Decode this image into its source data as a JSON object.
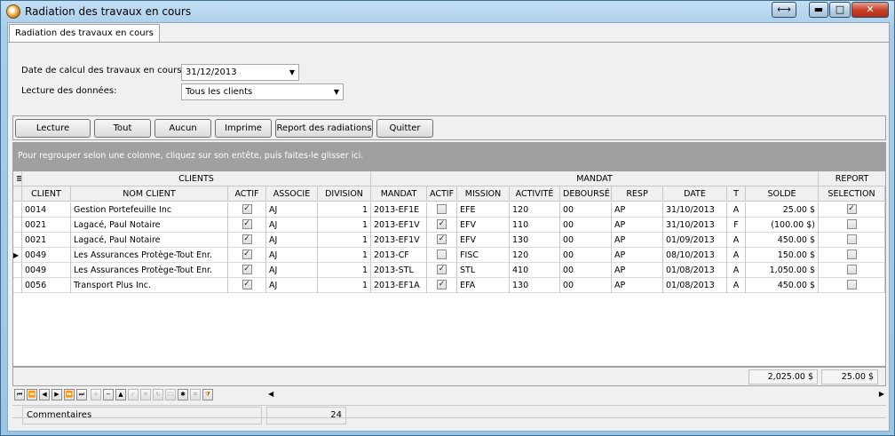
{
  "window": {
    "title": "Radiation des travaux en cours"
  },
  "titlebar_buttons": {
    "resize": "⟷",
    "minimize": "▬",
    "maximize": "□",
    "close": "✕"
  },
  "tab": {
    "label": "Radiation des travaux en cours"
  },
  "form": {
    "date_label": "Date de calcul des travaux en cours:",
    "date_value": "31/12/2013",
    "lecture_label": "Lecture des données:",
    "lecture_value": "Tous les clients"
  },
  "buttons": {
    "lecture": "Lecture",
    "tout": "Tout",
    "aucun": "Aucun",
    "imprime": "Imprime",
    "report": "Report des radiations",
    "quitter": "Quitter"
  },
  "group_hint": "Pour regrouper selon une colonne, cliquez sur son entête, puis faites-le glisser ici.",
  "bands": {
    "clients": "CLIENTS",
    "mandat": "MANDAT",
    "report": "REPORT"
  },
  "columns": [
    "CLIENT",
    "NOM CLIENT",
    "ACTIF",
    "ASSOCIE",
    "DIVISION",
    "MANDAT",
    "ACTIF",
    "MISSION",
    "ACTIVITÉ",
    "DEBOURSÉ",
    "RESP",
    "DATE",
    "T",
    "SOLDE",
    "SELECTION"
  ],
  "rows": [
    {
      "client": "0014",
      "nom": "Gestion Portefeuille Inc",
      "actif": true,
      "associe": "AJ",
      "division": "1",
      "mandat": "2013-EF1E",
      "mactif": false,
      "mission": "EFE",
      "activite": "120",
      "debourse": "00",
      "resp": "AP",
      "date": "31/10/2013",
      "t": "A",
      "solde": "25.00 $",
      "selection": true,
      "current": false
    },
    {
      "client": "0021",
      "nom": "Lagacé, Paul Notaire",
      "actif": true,
      "associe": "AJ",
      "division": "1",
      "mandat": "2013-EF1V",
      "mactif": true,
      "mission": "EFV",
      "activite": "110",
      "debourse": "00",
      "resp": "AP",
      "date": "31/10/2013",
      "t": "F",
      "solde": "(100.00 $)",
      "selection": false,
      "current": false
    },
    {
      "client": "0021",
      "nom": "Lagacé, Paul Notaire",
      "actif": true,
      "associe": "AJ",
      "division": "1",
      "mandat": "2013-EF1V",
      "mactif": true,
      "mission": "EFV",
      "activite": "130",
      "debourse": "00",
      "resp": "AP",
      "date": "01/09/2013",
      "t": "A",
      "solde": "450.00 $",
      "selection": false,
      "current": false
    },
    {
      "client": "0049",
      "nom": "Les Assurances Protège-Tout Enr.",
      "actif": true,
      "associe": "AJ",
      "division": "1",
      "mandat": "2013-CF",
      "mactif": false,
      "mission": "FISC",
      "activite": "120",
      "debourse": "00",
      "resp": "AP",
      "date": "08/10/2013",
      "t": "A",
      "solde": "150.00 $",
      "selection": false,
      "current": true
    },
    {
      "client": "0049",
      "nom": "Les Assurances Protège-Tout Enr.",
      "actif": true,
      "associe": "AJ",
      "division": "1",
      "mandat": "2013-STL",
      "mactif": true,
      "mission": "STL",
      "activite": "410",
      "debourse": "00",
      "resp": "AP",
      "date": "01/08/2013",
      "t": "A",
      "solde": "1,050.00 $",
      "selection": false,
      "current": false
    },
    {
      "client": "0056",
      "nom": "Transport Plus Inc.",
      "actif": true,
      "associe": "AJ",
      "division": "1",
      "mandat": "2013-EF1A",
      "mactif": true,
      "mission": "EFA",
      "activite": "130",
      "debourse": "00",
      "resp": "AP",
      "date": "01/08/2013",
      "t": "A",
      "solde": "450.00 $",
      "selection": false,
      "current": false
    }
  ],
  "totals": {
    "solde": "2,025.00 $",
    "selection": "25.00 $"
  },
  "status": {
    "commentaires_label": "Commentaires",
    "count": "24"
  }
}
